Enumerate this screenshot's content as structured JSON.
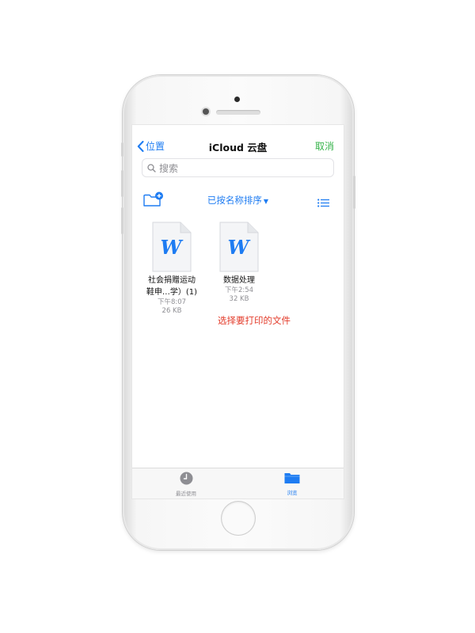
{
  "colors": {
    "accent": "#1e7cf2",
    "cancel": "#36b34a",
    "hint": "#e33b2a",
    "secondary": "#8e8e93"
  },
  "navbar": {
    "back_label": "位置",
    "title": "iCloud 云盘",
    "cancel_label": "取消"
  },
  "search": {
    "placeholder": "搜索"
  },
  "toolbar": {
    "new_folder_icon": "new-folder-icon",
    "sort_label": "已按名称排序",
    "list_icon": "list-view-icon"
  },
  "files": [
    {
      "name_line1": "社会捐赠运动",
      "name_line2": "鞋申…学）(1)",
      "time": "下午8:07",
      "size": "26 KB",
      "icon": "word-document-icon"
    },
    {
      "name_line1": "数据处理",
      "name_line2": "",
      "time": "下午2:54",
      "size": "32 KB",
      "icon": "word-document-icon"
    }
  ],
  "annotation": {
    "hint": "选择要打印的文件"
  },
  "tabbar": {
    "recents_label": "最近使用",
    "browse_label": "浏览"
  }
}
